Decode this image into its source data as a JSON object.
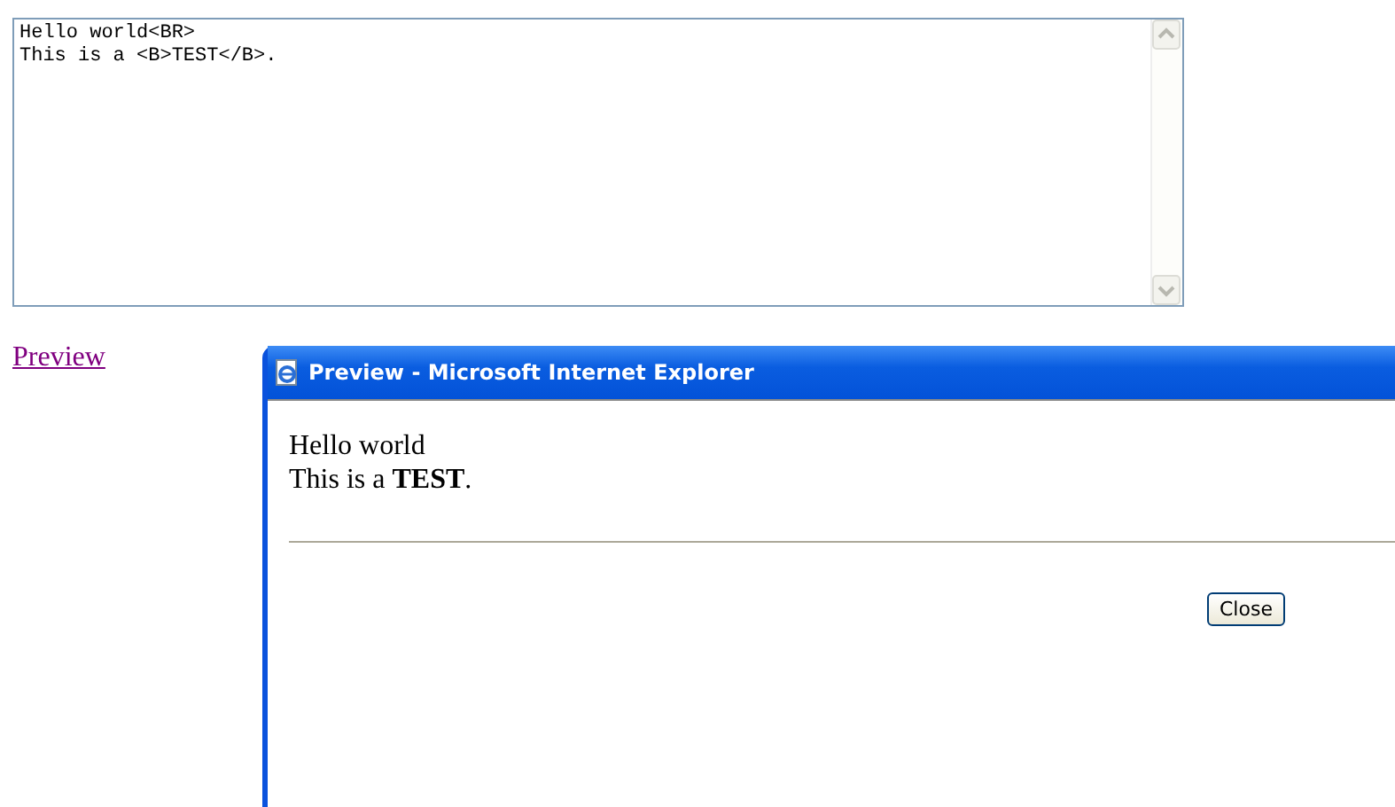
{
  "editor": {
    "value": "Hello world<BR>\nThis is a <B>TEST</B>."
  },
  "preview_link": {
    "label": "Preview"
  },
  "popup": {
    "title": "Preview - Microsoft Internet Explorer",
    "lines": [
      "Hello world",
      "This is a **TEST**."
    ],
    "close_button": "Close"
  }
}
